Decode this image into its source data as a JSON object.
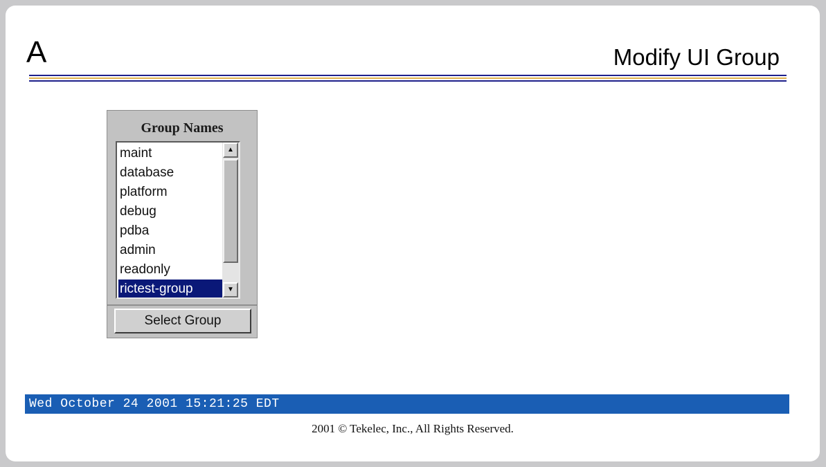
{
  "header": {
    "letter": "A",
    "title": "Modify UI Group"
  },
  "colors": {
    "rule_primary": "#1d1f8a",
    "rule_secondary": "#e0b24c",
    "selection": "#0a1878",
    "status_bar": "#1a5eb4"
  },
  "groups": {
    "title": "Group Names",
    "items": [
      "maint",
      "database",
      "platform",
      "debug",
      "pdba",
      "admin",
      "readonly",
      "rictest-group"
    ],
    "selected": "rictest-group",
    "scroll_up_icon": "arrow-up-icon",
    "scroll_down_icon": "arrow-down-icon",
    "button_label": "Select Group"
  },
  "status": {
    "datetime": "Wed October 24 2001 15:21:25 EDT"
  },
  "footer": {
    "copyright": "2001 © Tekelec, Inc., All Rights Reserved."
  }
}
